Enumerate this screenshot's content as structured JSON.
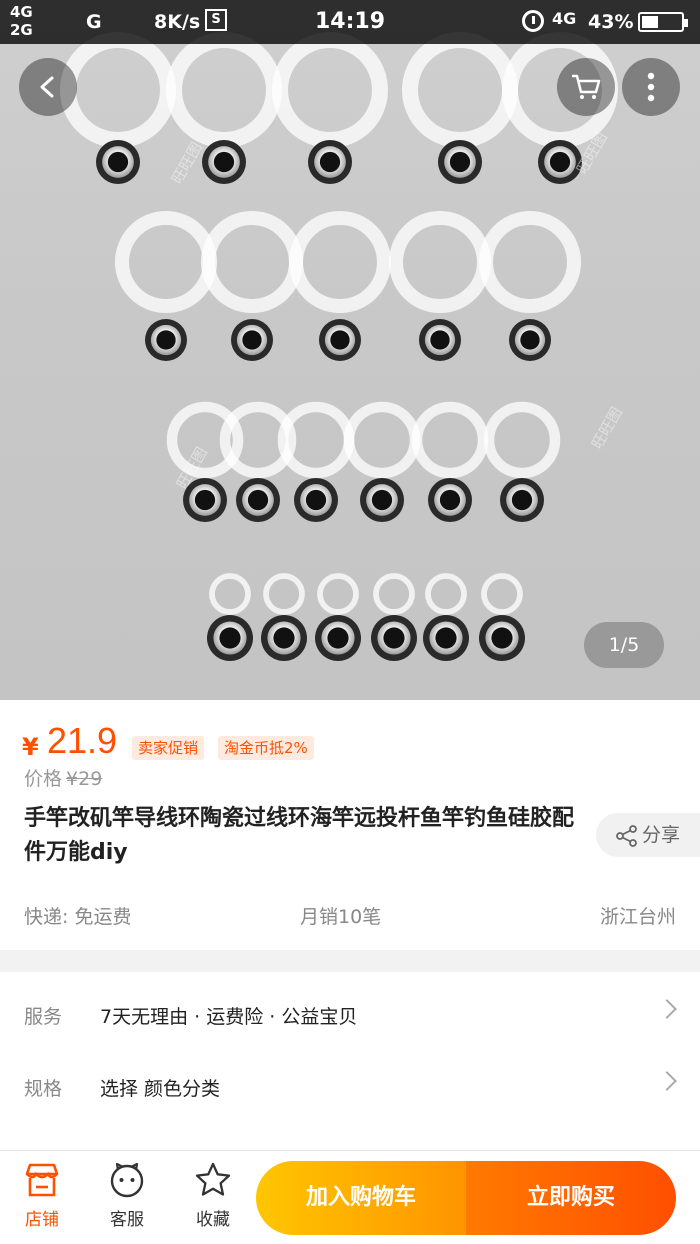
{
  "status_bar": {
    "network_top": "4G",
    "network_bottom": "2G",
    "carrier": "G",
    "speed": "8K/s",
    "stat_icon": "S",
    "time": "14:19",
    "network_right": "4G",
    "battery_text": "43%",
    "battery_level": 0.43
  },
  "gallery": {
    "pager": "1/5",
    "watermark": "旺旺图"
  },
  "product": {
    "currency": "¥",
    "price": "21.9",
    "tags": [
      "卖家促销",
      "淘金币抵2%"
    ],
    "orig_label": "价格",
    "orig_price": "¥29",
    "title": "手竿改矶竿导线环陶瓷过线环海竿远投杆鱼竿钓鱼硅胶配件万能diy",
    "share_label": "分享",
    "shipping": "快递: 免运费",
    "monthly_sales": "月销10笔",
    "location": "浙江台州"
  },
  "service": {
    "label": "服务",
    "value": "7天无理由 · 运费险 · 公益宝贝"
  },
  "spec": {
    "label": "规格",
    "value": "选择 颜色分类"
  },
  "bottom_bar": {
    "store": "店铺",
    "service": "客服",
    "favorite": "收藏",
    "add_to_cart": "加入购物车",
    "buy_now": "立即购买"
  },
  "colors": {
    "accent": "#ff5000",
    "cart_gradient_start": "#ffc600",
    "buy_gradient_end": "#ff4f00"
  },
  "icons": [
    "back-icon",
    "cart-icon",
    "more-icon",
    "share-icon",
    "store-icon",
    "chat-icon",
    "star-icon",
    "alarm-icon"
  ]
}
